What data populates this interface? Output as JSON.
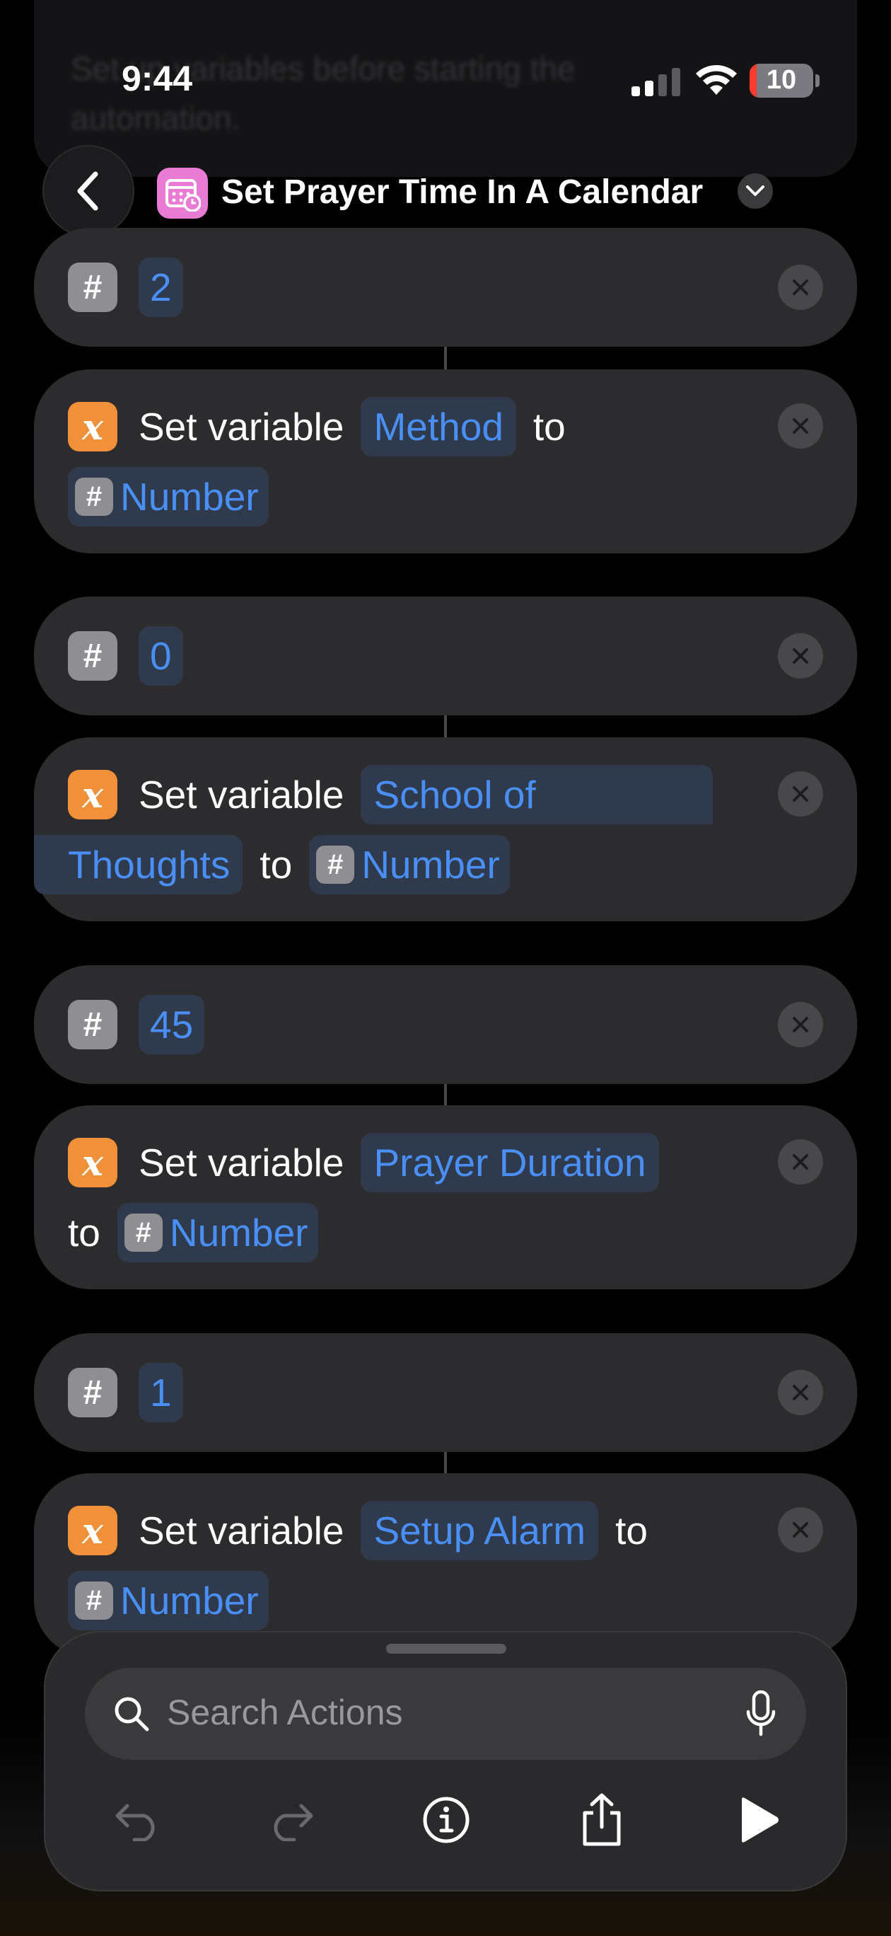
{
  "background_text": "Set up variables before starting the automation.",
  "status_bar": {
    "time": "9:44",
    "battery": "10"
  },
  "header": {
    "title": "Set Prayer Time In A Calendar"
  },
  "actions": [
    {
      "number": "2",
      "set_label": "Set variable",
      "variable": "Method",
      "to_label": "to",
      "value": "Number"
    },
    {
      "number": "0",
      "set_label": "Set variable",
      "variable_line1": "School of",
      "variable_line2": "Thoughts",
      "to_label": "to",
      "value": "Number"
    },
    {
      "number": "45",
      "set_label": "Set variable",
      "variable": "Prayer Duration",
      "to_label": "to",
      "value": "Number"
    },
    {
      "number": "1",
      "set_label": "Set variable",
      "variable": "Setup Alarm",
      "to_label": "to",
      "value": "Number"
    }
  ],
  "bottom_sheet": {
    "search_placeholder": "Search Actions"
  },
  "colors": {
    "accent_blue": "#4a8ff6",
    "variable_orange": "#f0913a",
    "card_bg": "#2c2c2e"
  }
}
